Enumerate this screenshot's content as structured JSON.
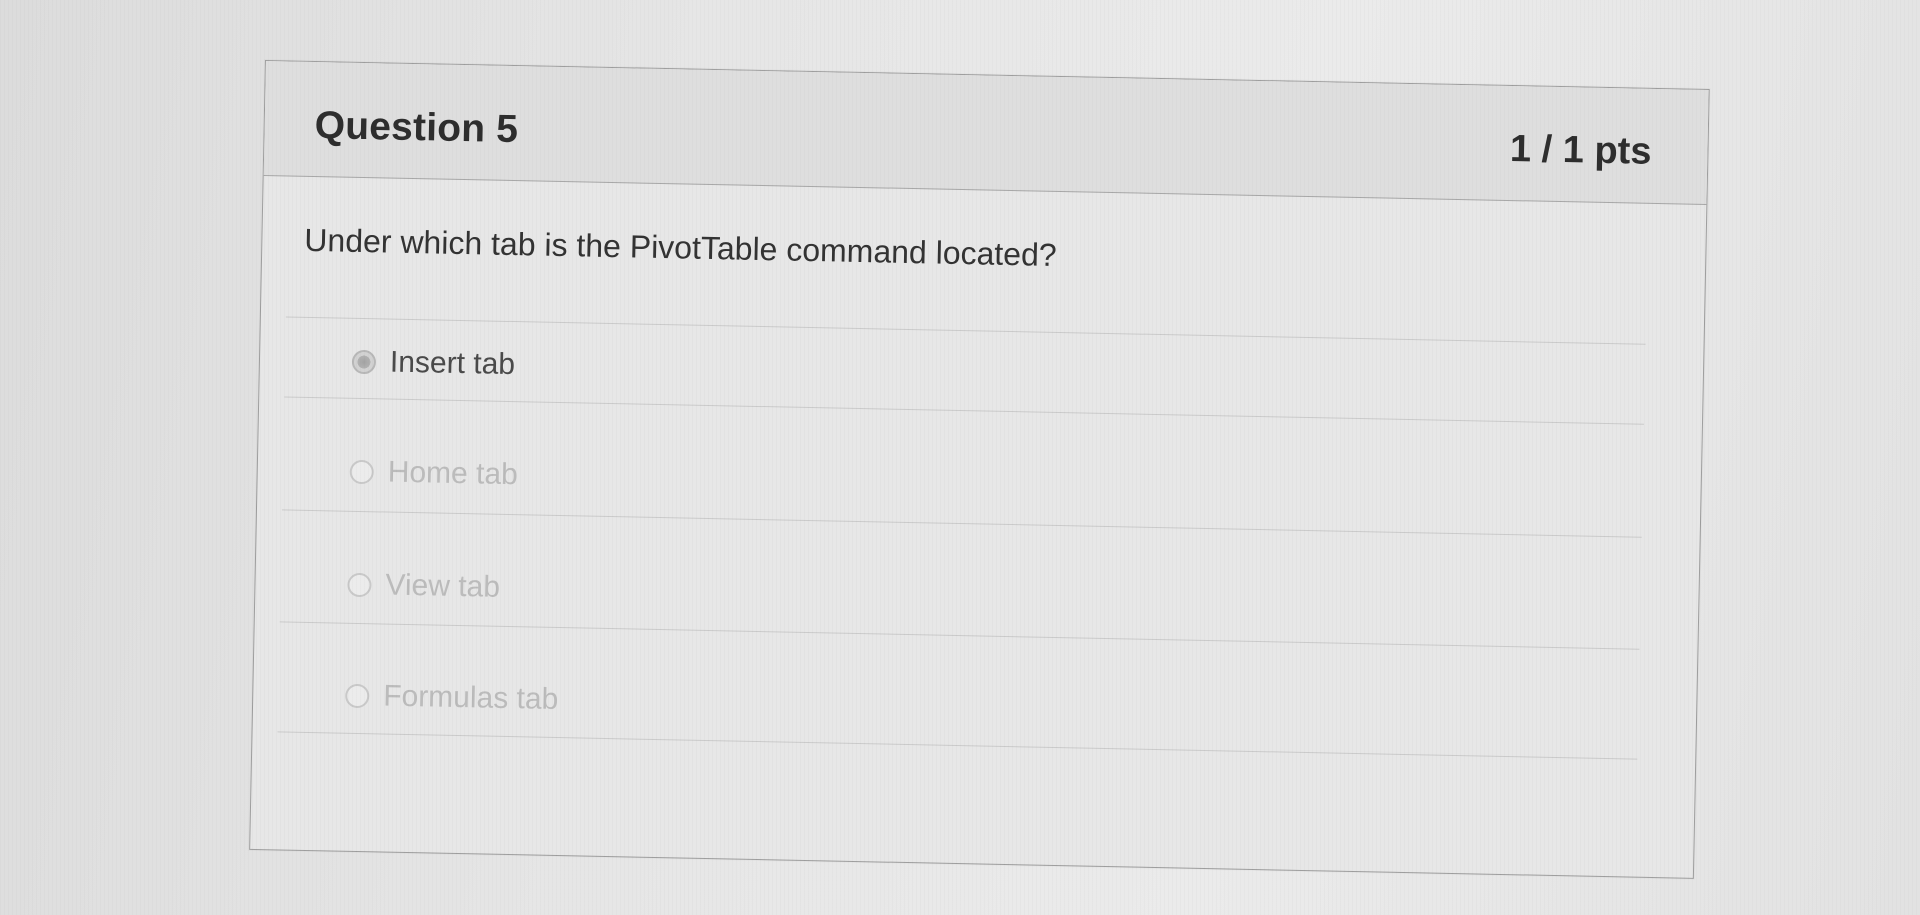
{
  "question": {
    "title": "Question 5",
    "points": "1 / 1 pts",
    "prompt": "Under which tab is the PivotTable command located?"
  },
  "answers": [
    {
      "label": "Insert tab",
      "selected": true
    },
    {
      "label": "Home tab",
      "selected": false
    },
    {
      "label": "View tab",
      "selected": false
    },
    {
      "label": "Formulas tab",
      "selected": false
    }
  ],
  "colors": {
    "header_bg": "#dedede",
    "card_bg": "#e7e7e7",
    "text_dark": "#2e2e2e",
    "text_muted": "#bcbcbc"
  }
}
